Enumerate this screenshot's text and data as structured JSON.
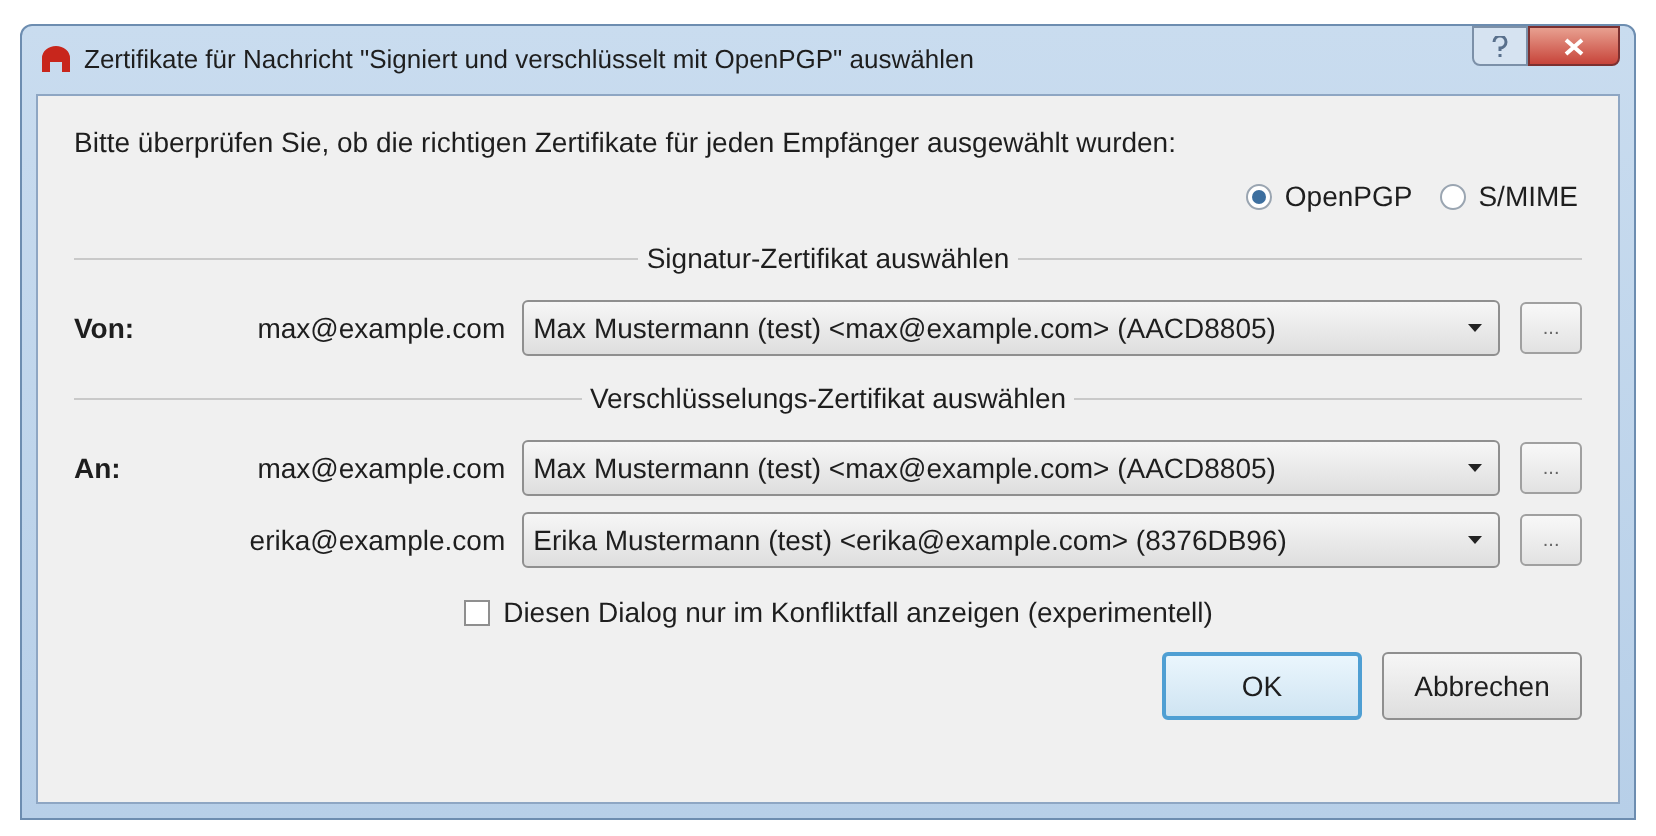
{
  "window": {
    "title": "Zertifikate für Nachricht \"Signiert und verschlüsselt mit OpenPGP\" auswählen"
  },
  "intro": "Bitte überprüfen Sie, ob die richtigen Zertifikate für jeden Empfänger ausgewählt wurden:",
  "protocols": [
    {
      "label": "OpenPGP",
      "selected": true
    },
    {
      "label": "S/MIME",
      "selected": false
    }
  ],
  "sections": [
    {
      "heading": "Signatur-Zertifikat auswählen",
      "rows": [
        {
          "label": "Von:",
          "email": "max@example.com",
          "certificate": "Max Mustermann (test) <max@example.com> (AACD8805)",
          "browse": "..."
        }
      ]
    },
    {
      "heading": "Verschlüsselungs-Zertifikat auswählen",
      "rows": [
        {
          "label": "An:",
          "email": "max@example.com",
          "certificate": "Max Mustermann (test) <max@example.com> (AACD8805)",
          "browse": "..."
        },
        {
          "email": "erika@example.com",
          "certificate": "Erika Mustermann (test) <erika@example.com> (8376DB96)",
          "browse": "..."
        }
      ]
    }
  ],
  "conflict_option": {
    "label": "Diesen Dialog nur im Konfliktfall anzeigen (experimentell)",
    "checked": false
  },
  "buttons": [
    {
      "label": "OK",
      "default": true
    },
    {
      "label": "Abbrechen",
      "default": false
    }
  ]
}
